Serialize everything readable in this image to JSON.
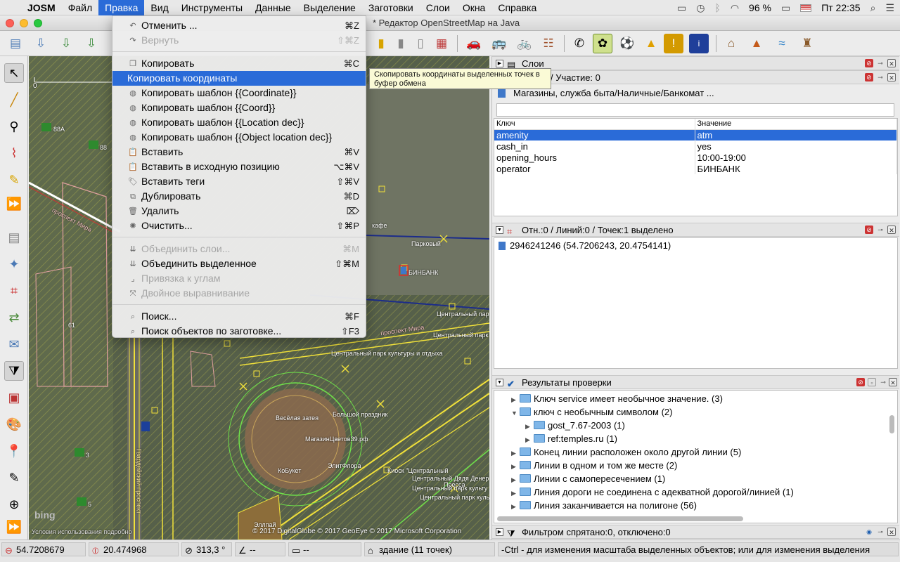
{
  "menubar": {
    "app": "JOSM",
    "items": [
      "Файл",
      "Правка",
      "Вид",
      "Инструменты",
      "Данные",
      "Выделение",
      "Заготовки",
      "Слои",
      "Окна",
      "Справка"
    ],
    "active_index": 1,
    "battery": "96 %",
    "clock": "Пт 22:35"
  },
  "window": {
    "title": "* Редактор OpenStreetMap на Java"
  },
  "edit_menu": {
    "items": [
      {
        "label": "Отменить ...",
        "shortcut": "⌘Z",
        "disabled": false,
        "icon": "undo-icon"
      },
      {
        "label": "Вернуть",
        "shortcut": "⇧⌘Z",
        "disabled": true,
        "icon": "redo-icon"
      },
      {
        "label": "Копировать",
        "shortcut": "⌘C",
        "disabled": false,
        "icon": "copy-icon"
      },
      {
        "label": "Копировать координаты",
        "shortcut": "",
        "disabled": false,
        "highlighted": true,
        "icon": ""
      },
      {
        "label": "Копировать шаблон {{Coordinate}}",
        "shortcut": "",
        "disabled": false,
        "icon": "wiki-icon"
      },
      {
        "label": "Копировать шаблон {{Coord}}",
        "shortcut": "",
        "disabled": false,
        "icon": "wiki-icon"
      },
      {
        "label": "Копировать шаблон {{Location dec}}",
        "shortcut": "",
        "disabled": false,
        "icon": "wiki-icon"
      },
      {
        "label": "Копировать шаблон {{Object location dec}}",
        "shortcut": "",
        "disabled": false,
        "icon": "wiki-icon"
      },
      {
        "label": "Вставить",
        "shortcut": "⌘V",
        "disabled": false,
        "icon": "paste-icon"
      },
      {
        "label": "Вставить в исходную позицию",
        "shortcut": "⌥⌘V",
        "disabled": false,
        "icon": "paste-icon"
      },
      {
        "label": "Вставить теги",
        "shortcut": "⇧⌘V",
        "disabled": false,
        "icon": "paste-tags-icon"
      },
      {
        "label": "Дублировать",
        "shortcut": "⌘D",
        "disabled": false,
        "icon": "duplicate-icon"
      },
      {
        "label": "Удалить",
        "shortcut": "⌦",
        "disabled": false,
        "icon": "delete-icon"
      },
      {
        "label": "Очистить...",
        "shortcut": "⇧⌘P",
        "disabled": false,
        "icon": "purge-icon"
      },
      {
        "label": "Объединить слои...",
        "shortcut": "⌘M",
        "disabled": true,
        "icon": "merge-layers-icon"
      },
      {
        "label": "Объединить выделенное",
        "shortcut": "⇧⌘M",
        "disabled": false,
        "icon": "merge-selection-icon"
      },
      {
        "label": "Привязка к углам",
        "shortcut": "",
        "disabled": true,
        "icon": "snap-icon"
      },
      {
        "label": "Двойное выравнивание",
        "shortcut": "",
        "disabled": true,
        "icon": "double-align-icon"
      },
      {
        "label": "Поиск...",
        "shortcut": "⌘F",
        "disabled": false,
        "icon": "search-icon"
      },
      {
        "label": "Поиск объектов по заготовке...",
        "shortcut": "⇧F3",
        "disabled": false,
        "icon": "preset-search-icon"
      }
    ],
    "tooltip": "Скопировать координаты выделенных точек в буфер обмена"
  },
  "map": {
    "scale_start": "0",
    "labels": [
      "Парковый",
      "БИНБАНК",
      "кафе",
      "Центральный пар",
      "Центральный парк",
      "Центральный парк культуры и отдыха",
      "Весёлая затея",
      "Большой праздник",
      "МагазинЦветов39.рф",
      "КоБукет",
      "ЭлитФлора",
      "Киоск \"Центральный",
      "Центральный Дядя Денер",
      "Пресса",
      "Центральный парк культу",
      "Центральный парк куль",
      "Эллпай",
      "проспект Мира",
      "проспект Мира",
      "Гвардейский проспект",
      "61",
      "88А",
      "88",
      "3",
      "5"
    ],
    "attribution": "© 2017 DigitalGlobe © 2017 GeoEye © 2017 Microsoft Corporation",
    "terms": "Условия использования подробно",
    "bing": "bing"
  },
  "panels": {
    "layers": {
      "title": "Слои"
    },
    "tags": {
      "title": "/ Участие: 0",
      "preset": "Магазины, служба быта/Наличные/Банкомат ...",
      "col_key": "Ключ",
      "col_value": "Значение",
      "rows": [
        {
          "key": "amenity",
          "value": "atm"
        },
        {
          "key": "cash_in",
          "value": "yes"
        },
        {
          "key": "opening_hours",
          "value": "10:00-19:00"
        },
        {
          "key": "operator",
          "value": "БИНБАНК"
        }
      ]
    },
    "selection": {
      "title": "Отн.:0 / Линий:0 / Точек:1 выделено",
      "items": [
        "2946241246 (54.7206243, 20.4754141)"
      ]
    },
    "validation": {
      "title": "Результаты проверки",
      "rows": [
        {
          "label": "Ключ service имеет необычное значение. (3)",
          "level": 0,
          "expanded": false
        },
        {
          "label": "ключ с необычным символом (2)",
          "level": 0,
          "expanded": true
        },
        {
          "label": "gost_7.67-2003 (1)",
          "level": 1,
          "expanded": false
        },
        {
          "label": "ref:temples.ru (1)",
          "level": 1,
          "expanded": false
        },
        {
          "label": "Конец линии расположен около другой линии (5)",
          "level": 0,
          "expanded": false
        },
        {
          "label": "Линии в одном и том же месте (2)",
          "level": 0,
          "expanded": false
        },
        {
          "label": "Линии с самопересечением (1)",
          "level": 0,
          "expanded": false
        },
        {
          "label": "Линия дороги не соединена с адекватной дорогой/линией (1)",
          "level": 0,
          "expanded": false
        },
        {
          "label": "Линия заканчивается на полигоне (56)",
          "level": 0,
          "expanded": false
        }
      ]
    },
    "filter": {
      "title": "Фильтром спрятано:0, отключено:0"
    }
  },
  "status": {
    "lat": "54.7208679",
    "lon": "20.474968",
    "heading": "313,3 °",
    "angle": "--",
    "distance": "--",
    "member": "здание (11 точек)",
    "help": "-Ctrl - для изменения масштаба выделенных объектов; или для изменения выделения"
  }
}
